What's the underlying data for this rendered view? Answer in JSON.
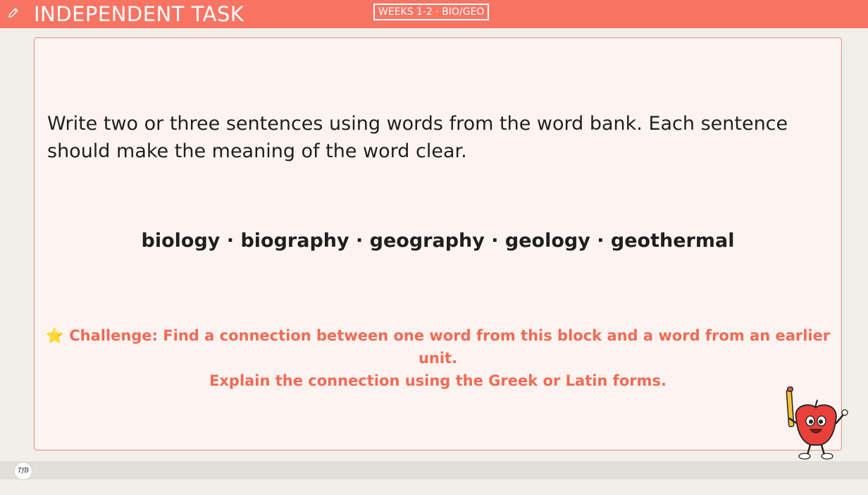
{
  "header": {
    "title": "INDEPENDENT TASK",
    "badge": "WEEKS 1-2 · BIO/GEO",
    "icon": "pencil-icon"
  },
  "task": {
    "instructions": "Write two or three sentences using words from the word bank. Each sentence should make the meaning of the word clear.",
    "word_bank": "biology · biography · geography · geology · geothermal",
    "challenge_line1": "⭐ Challenge: Find a connection between one word from this block and a word from an earlier unit.",
    "challenge_line2": "Explain the connection using the Greek or Latin forms."
  },
  "footer": {
    "logo_text": "TfB"
  },
  "colors": {
    "accent": "#f97463",
    "challenge": "#f26a55",
    "card_bg": "#fdf4f1"
  }
}
